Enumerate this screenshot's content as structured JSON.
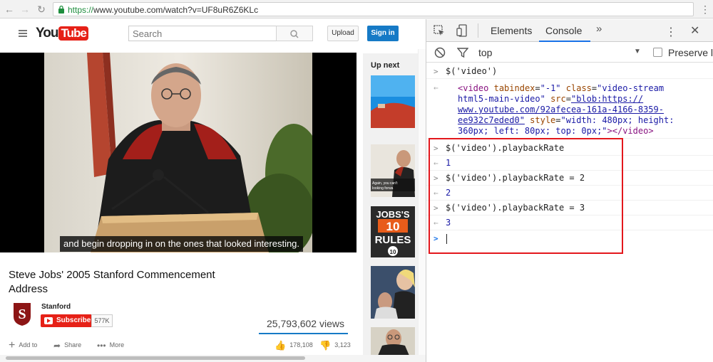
{
  "browser": {
    "url_scheme": "https://",
    "url_rest": "www.youtube.com/watch?v=UF8uR6Z6KLc",
    "back_icon": "arrow-left-icon",
    "forward_icon": "arrow-right-icon",
    "reload_icon": "reload-icon"
  },
  "youtube": {
    "logo_you": "You",
    "logo_tube": "Tube",
    "search_placeholder": "Search",
    "upload_label": "Upload",
    "signin_label": "Sign in",
    "subtitle": "and begin dropping in on the ones that looked interesting.",
    "up_next_label": "Up next",
    "video_title": "Steve Jobs' 2005 Stanford Commencement Address",
    "channel_name": "Stanford",
    "subscribe_label": "Subscribe",
    "subscriber_count": "577K",
    "views": "25,793,602 views",
    "actions": {
      "add_to": "Add to",
      "share": "Share",
      "more": "More",
      "likes": "178,108",
      "dislikes": "3,123"
    },
    "thumbs": {
      "t2_caption": "Again, you can't connect looking forwa",
      "t3_text_a": "JOBS'S",
      "t3_text_b": "10",
      "t3_text_c": "RULES",
      "t3_badge": "10"
    },
    "accent_red": "#e62117",
    "accent_blue": "#167ac6"
  },
  "devtools": {
    "tabs": [
      "Elements",
      "Console"
    ],
    "active_tab": "Console",
    "more_tabs_icon": "double-chevron-right-icon",
    "context": "top",
    "preserve_label": "Preserve l",
    "console_lines": [
      {
        "kind": "input",
        "text": "$('video')"
      },
      {
        "kind": "output-element",
        "line1_tag_open": "<video",
        "line1_attr1": "tabindex",
        "line1_val1": "\"-1\"",
        "line1_attr2": "class",
        "line1_val2": "\"video-stream",
        "line2": "html5-main-video\"",
        "line2_attr": "src",
        "line2_link": "\"blob:https://",
        "line3_link": "www.youtube.com/92afecea-161a-4166-8359-",
        "line4_link": "ee932c7eded0\"",
        "line4_attr": "style",
        "line4_val": "\"width: 480px; height:",
        "line5_val": "360px; left: 80px; top: 0px;\"",
        "line5_close": "></video>"
      },
      {
        "kind": "input",
        "text": "$('video').playbackRate"
      },
      {
        "kind": "output",
        "text": "1"
      },
      {
        "kind": "input",
        "text": "$('video').playbackRate = 2"
      },
      {
        "kind": "output",
        "text": "2"
      },
      {
        "kind": "input",
        "text": "$('video').playbackRate = 3"
      },
      {
        "kind": "output",
        "text": "3"
      }
    ],
    "highlight_color": "#e3171c"
  }
}
